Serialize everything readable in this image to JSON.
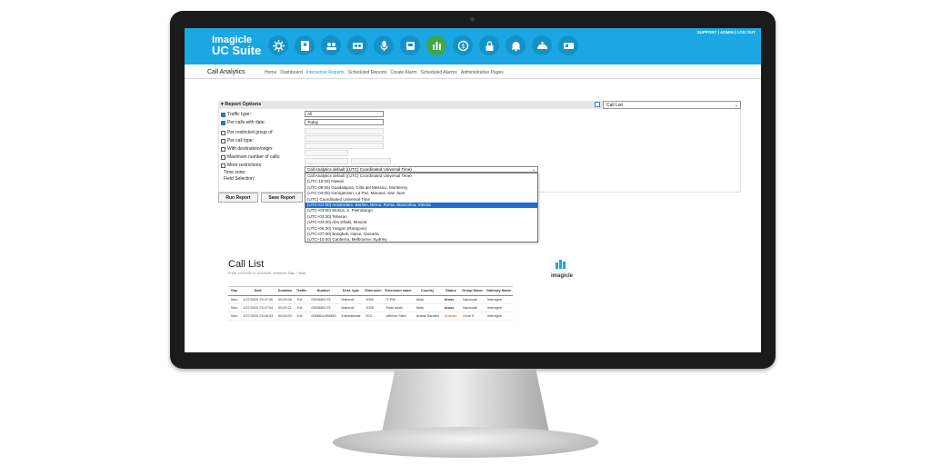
{
  "header": {
    "brand_line1": "Imagicle",
    "brand_line2": "UC Suite",
    "links": "SUPPORT | ADMIN | LOG OUT",
    "icons": [
      "gear-icon",
      "contacts-icon",
      "attendant-icon",
      "recording-icon",
      "voice-icon",
      "fax-icon",
      "analytics-icon",
      "billing-icon",
      "lock-icon",
      "bell-icon",
      "queue-icon",
      "messaging-icon"
    ],
    "active_color": "#3fa845",
    "brand_color": "#1aa7e3"
  },
  "nav": {
    "app_title": "Call Analytics",
    "items": [
      "Home",
      "Dashboard",
      "Interactive Reports",
      "Scheduled Reports",
      "Create Alarm",
      "Scheduled Alarms",
      "Administrative Pages"
    ]
  },
  "report_options": {
    "title": "Report Options",
    "report_select": "Call List",
    "traffic_type_label": "Traffic type:",
    "traffic_type_value": "All",
    "per_calls_label": "Per calls with date:",
    "per_calls_value": "Today",
    "restricted_label": "Per restricted group of:",
    "call_type_label": "Per call type:",
    "destination_label": "With destination/origin:",
    "max_calls_label": "Maximum number of calls:",
    "more_label": "More restrictions:",
    "timezone_label": "Time zone:",
    "field_selection_label": "Field Selection:",
    "timezone_value": "Call Analytics default ((UTC) Coordinated Universal Time)",
    "timezone_options": [
      "Call Analytics default ((UTC) Coordinated Universal Time)",
      "(UTC-10:00) Hawaii",
      "(UTC-06:00) Guadalajara, Città del Messico, Monterrey",
      "(UTC-04:00) Georgetown, La Paz, Manaus, San Juan",
      "(UTC) Coordinated Universal Time",
      "(UTC+01:00) Amsterdam, Berlino, Berna, Roma, Stoccolma, Vienna",
      "(UTC+03:00) Mosca, S. Pietroburgo",
      "(UTC+03:30) Teheran",
      "(UTC+04:00) Abu Dhabi, Muscat",
      "(UTC+06:30) Yangon (Rangoon)",
      "(UTC+07:00) Bangkok, Hanoi, Giacarta",
      "(UTC+10:00) Canberra, Melbourne, Sydney"
    ],
    "highlighted_index": 5,
    "run_label": "Run Report",
    "save_label": "Save Report"
  },
  "call_list": {
    "title": "Call List",
    "subtitle": "From 1/1/2020 to 2/1/2020, external, Day = Mon",
    "logo": "imagicle",
    "columns": [
      "Day",
      "Date",
      "Duration",
      "Traffic",
      "Number",
      "Dest. type",
      "Extension",
      "Extension name",
      "Country",
      "Status",
      "Group Name",
      "Gateway Name"
    ],
    "rows": [
      [
        "Mon",
        "1/27/2020 23:47:30",
        "00:00:06",
        "Ext.",
        "0345684175",
        "National",
        "0000",
        "IT RM",
        "Italia",
        "Answ.",
        "Nazionali",
        "Interagire"
      ],
      [
        "Mon",
        "1/27/2020 23:47:04",
        "00:00:21",
        "Ext.",
        "0345684175",
        "National",
        "0008",
        "Sistri audio",
        "Italia",
        "Answ.",
        "Nazionali",
        "Interagire"
      ],
      [
        "Mon",
        "1/27/2020 23:46:53",
        "00:00:00",
        "Ext.",
        "0088811494963",
        "International",
        "003",
        "Ufficine Sistri",
        "Arabia Saudita",
        "Unansw.",
        "Zone 5",
        "Interagire"
      ]
    ]
  }
}
